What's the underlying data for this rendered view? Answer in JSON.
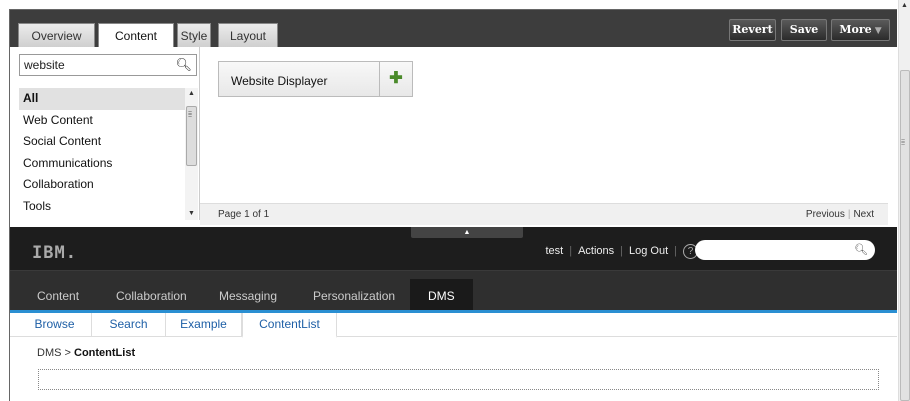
{
  "customize": {
    "tabs": [
      "Overview",
      "Content",
      "Style",
      "Layout"
    ],
    "active_tab": "Content",
    "buttons": {
      "revert": "Revert",
      "save": "Save",
      "more": "More"
    },
    "search": {
      "value": "website",
      "placeholder": ""
    },
    "categories": [
      "All",
      "Web Content",
      "Social Content",
      "Communications",
      "Collaboration",
      "Tools"
    ],
    "selected_category": "All",
    "results": [
      {
        "label": "Website Displayer"
      }
    ],
    "pager": {
      "info": "Page 1 of 1",
      "previous": "Previous",
      "next": "Next"
    }
  },
  "portal": {
    "logo": "IBM.",
    "header_links": [
      "test",
      "Actions",
      "Log Out"
    ],
    "help": "?",
    "search_placeholder": "",
    "nav": [
      "Content",
      "Collaboration",
      "Messaging",
      "Personalization",
      "DMS"
    ],
    "active_nav": "DMS",
    "subtabs": [
      "Browse",
      "Search",
      "Example",
      "ContentList"
    ],
    "active_subtab": "ContentList",
    "breadcrumb": {
      "parent": "DMS",
      "separator": ">",
      "current": "ContentList"
    }
  },
  "colors": {
    "accent_blue": "#2a8fd2",
    "dark_header": "#1d1d1d",
    "nav_bar": "#2f2f2f"
  },
  "icons": {
    "search": "magnifier-icon",
    "add": "plus-icon",
    "help": "help-icon"
  }
}
